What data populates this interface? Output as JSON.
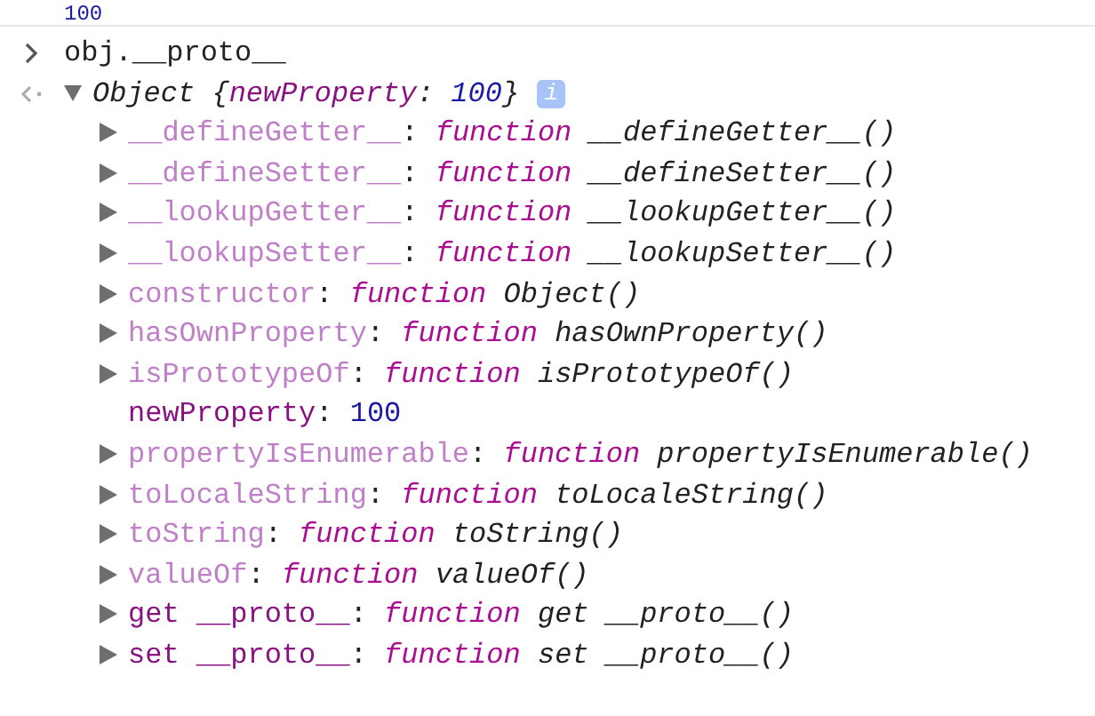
{
  "previous_result": {
    "value": "100"
  },
  "input": {
    "text": "obj.__proto__"
  },
  "result": {
    "expanded": true,
    "class_name": "Object",
    "open": "{",
    "preview_name": "newProperty",
    "preview_colon": ":",
    "preview_value": "100",
    "close": "}",
    "info_badge": "i",
    "children": [
      {
        "kind": "function",
        "dimmed": true,
        "expanded": false,
        "name": "__defineGetter__",
        "colon": ":",
        "keyword": "function",
        "signature": "__defineGetter__()"
      },
      {
        "kind": "function",
        "dimmed": true,
        "expanded": false,
        "name": "__defineSetter__",
        "colon": ":",
        "keyword": "function",
        "signature": "__defineSetter__()"
      },
      {
        "kind": "function",
        "dimmed": true,
        "expanded": false,
        "name": "__lookupGetter__",
        "colon": ":",
        "keyword": "function",
        "signature": "__lookupGetter__()"
      },
      {
        "kind": "function",
        "dimmed": true,
        "expanded": false,
        "name": "__lookupSetter__",
        "colon": ":",
        "keyword": "function",
        "signature": "__lookupSetter__()"
      },
      {
        "kind": "function",
        "dimmed": true,
        "expanded": false,
        "name": "constructor",
        "colon": ":",
        "keyword": "function",
        "signature": "Object()"
      },
      {
        "kind": "function",
        "dimmed": true,
        "expanded": false,
        "name": "hasOwnProperty",
        "colon": ":",
        "keyword": "function",
        "signature": "hasOwnProperty()"
      },
      {
        "kind": "function",
        "dimmed": true,
        "expanded": false,
        "name": "isPrototypeOf",
        "colon": ":",
        "keyword": "function",
        "signature": "isPrototypeOf()"
      },
      {
        "kind": "number",
        "dimmed": false,
        "name": "newProperty",
        "colon": ":",
        "value": "100"
      },
      {
        "kind": "function",
        "dimmed": true,
        "expanded": false,
        "name": "propertyIsEnumerable",
        "colon": ":",
        "keyword": "function",
        "signature": "propertyIsEnumerable()"
      },
      {
        "kind": "function",
        "dimmed": true,
        "expanded": false,
        "name": "toLocaleString",
        "colon": ":",
        "keyword": "function",
        "signature": "toLocaleString()"
      },
      {
        "kind": "function",
        "dimmed": true,
        "expanded": false,
        "name": "toString",
        "colon": ":",
        "keyword": "function",
        "signature": "toString()"
      },
      {
        "kind": "function",
        "dimmed": true,
        "expanded": false,
        "name": "valueOf",
        "colon": ":",
        "keyword": "function",
        "signature": "valueOf()"
      },
      {
        "kind": "function",
        "dimmed": false,
        "expanded": false,
        "name": "get __proto__",
        "colon": ":",
        "keyword": "function",
        "signature": "get __proto__()"
      },
      {
        "kind": "function",
        "dimmed": false,
        "expanded": false,
        "name": "set __proto__",
        "colon": ":",
        "keyword": "function",
        "signature": "set __proto__()"
      }
    ]
  }
}
